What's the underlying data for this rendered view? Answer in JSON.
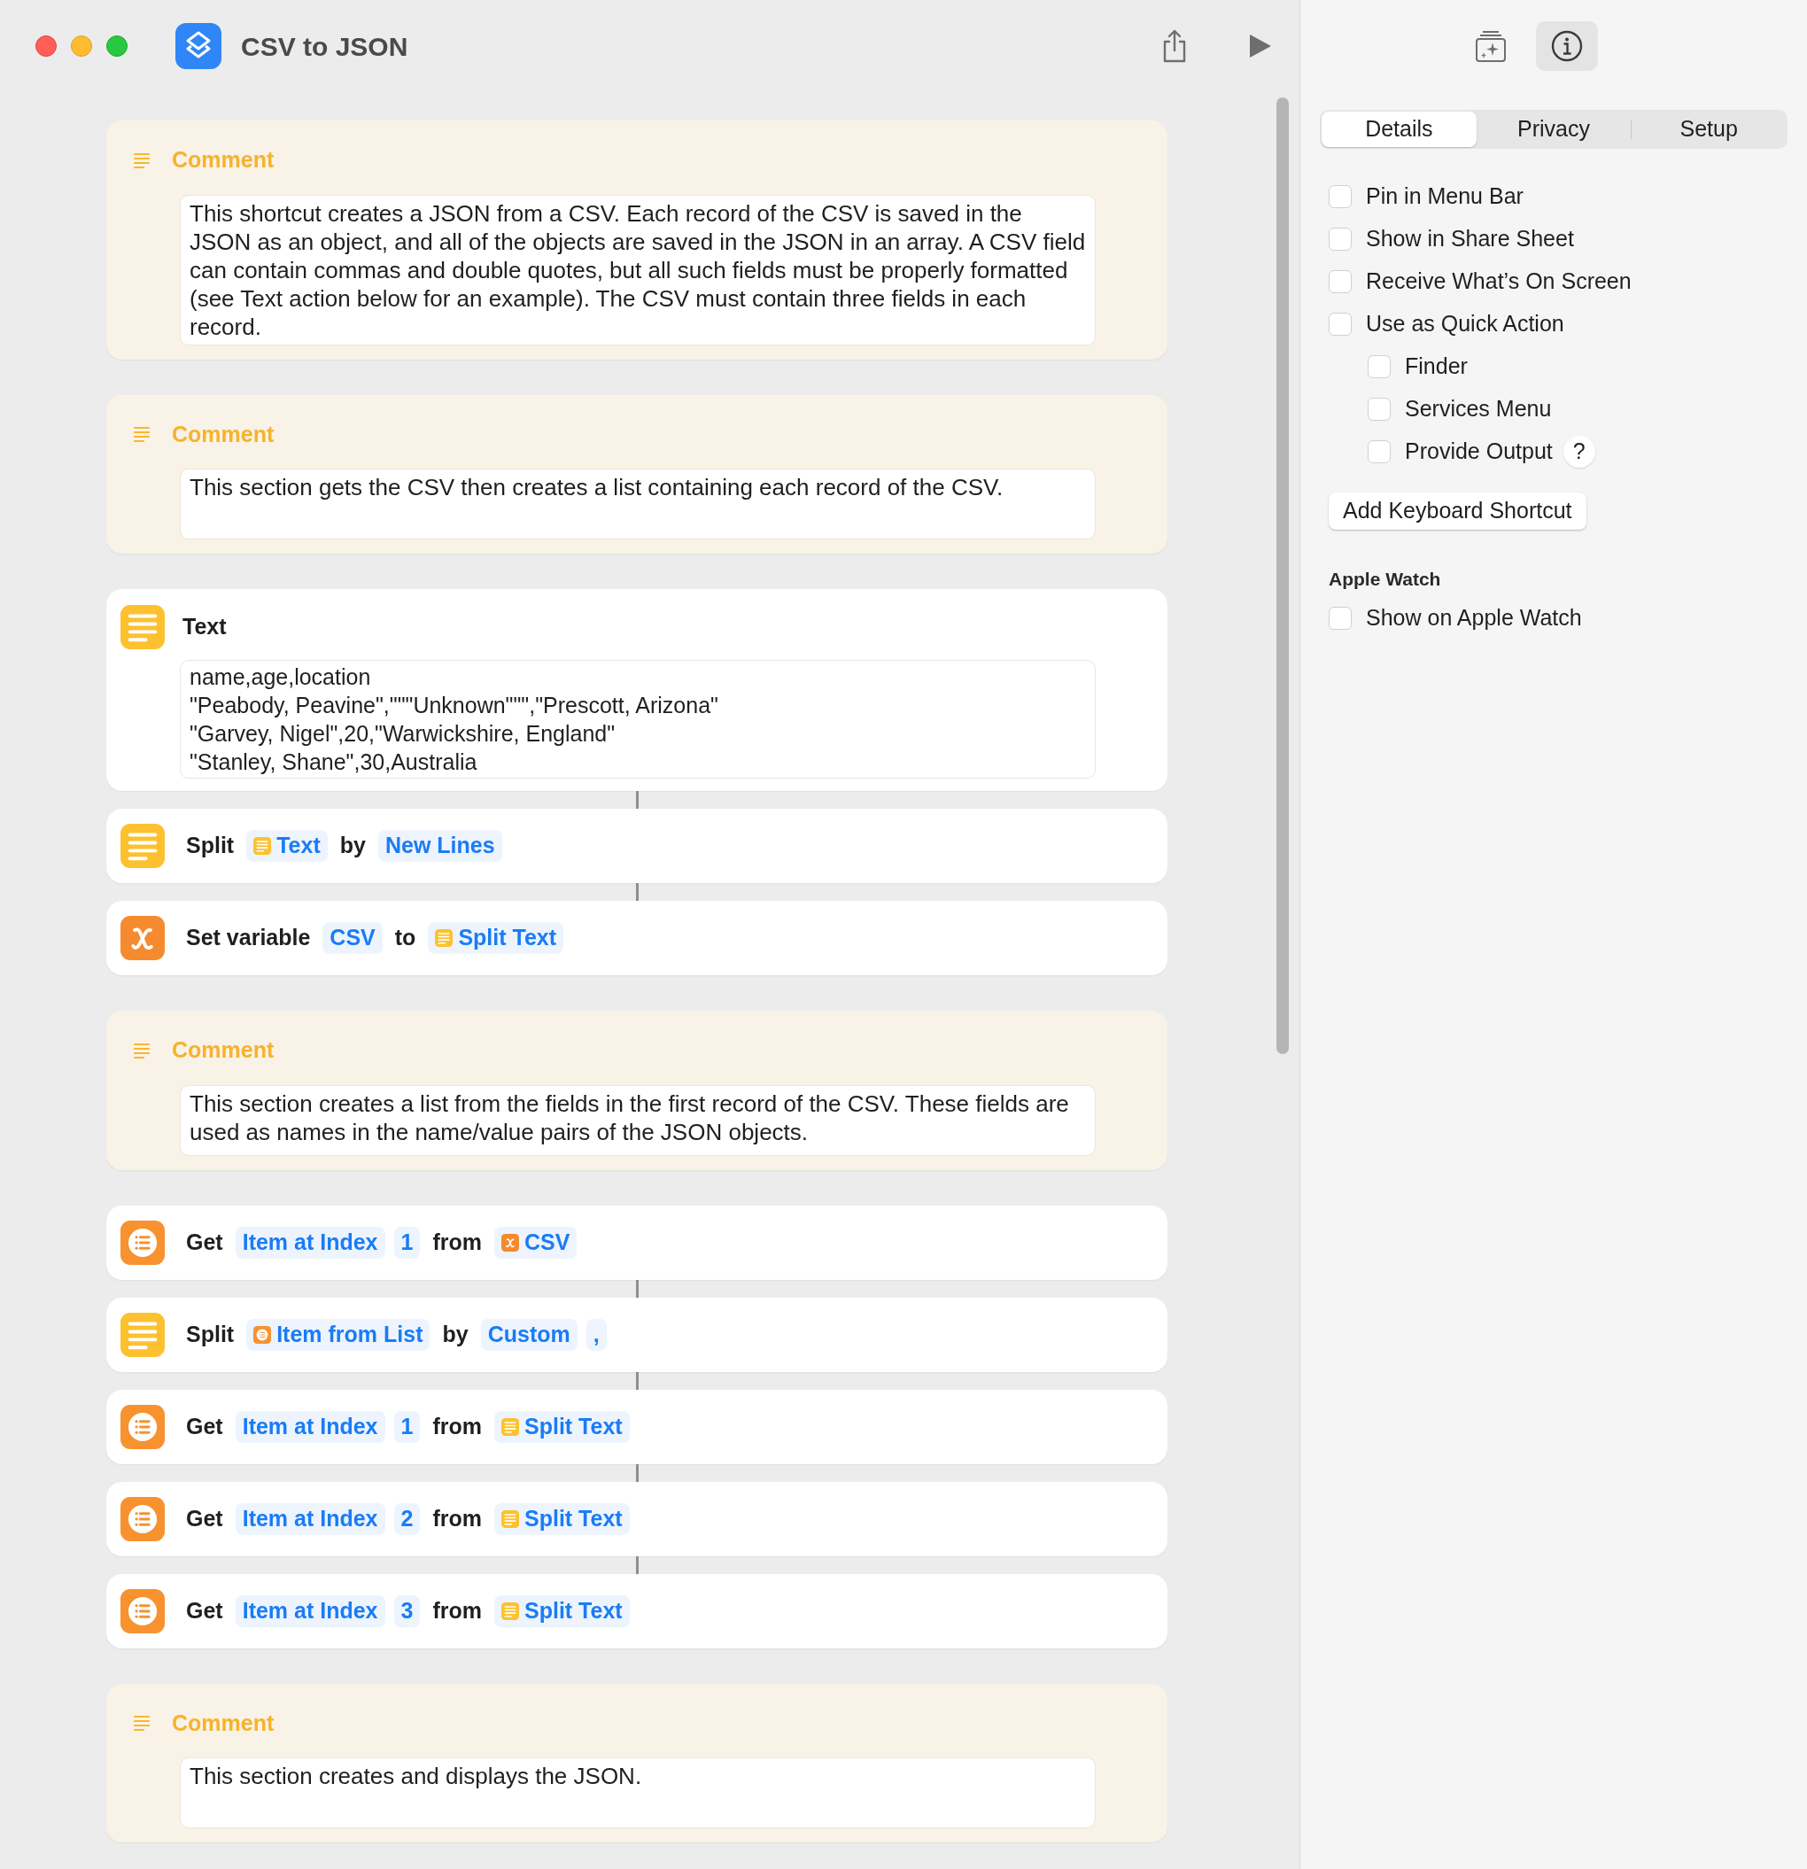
{
  "window": {
    "title": "CSV to JSON"
  },
  "blocks": [
    {
      "kind": "comment",
      "title": "Comment",
      "body": "This shortcut creates a JSON from a CSV. Each record of the CSV is saved in the JSON as an object, and all of the objects are saved in the JSON in an array.  A CSV field can contain commas and double quotes, but all such fields must be properly formatted (see Text action below for an example). The CSV must contain three fields in each record."
    },
    {
      "kind": "comment",
      "title": "Comment",
      "body": "This section gets the CSV then creates a list containing each record of the CSV."
    },
    {
      "kind": "text",
      "title": "Text",
      "lines": [
        "name,age,location",
        "\"Peabody, Peavine\",\"\"\"Unknown\"\"\",\"Prescott, Arizona\"",
        "\"Garvey, Nigel\",20,\"Warwickshire, England\"",
        "\"Stanley, Shane\",30,Australia"
      ]
    },
    {
      "kind": "split_text",
      "parts": [
        {
          "kind": "word",
          "text": "Split"
        },
        {
          "kind": "text_token",
          "text": "Text"
        },
        {
          "kind": "word",
          "text": "by"
        },
        {
          "kind": "token",
          "text": "New Lines"
        }
      ]
    },
    {
      "kind": "set_variable",
      "parts": [
        {
          "kind": "word",
          "text": "Set variable"
        },
        {
          "kind": "token",
          "text": "CSV"
        },
        {
          "kind": "word",
          "text": "to"
        },
        {
          "kind": "text_token",
          "text": "Split Text"
        }
      ]
    },
    {
      "kind": "comment",
      "title": "Comment",
      "body": "This section creates a list from the fields in the first record of the CSV. These fields are used as names in the name/value pairs of the JSON objects."
    },
    {
      "kind": "get_item",
      "parts": [
        {
          "kind": "word",
          "text": "Get"
        },
        {
          "kind": "token",
          "text": "Item at Index"
        },
        {
          "kind": "token",
          "text": "1"
        },
        {
          "kind": "word",
          "text": "from"
        },
        {
          "kind": "variable_token",
          "text": "CSV"
        }
      ]
    },
    {
      "kind": "split_text",
      "parts": [
        {
          "kind": "word",
          "text": "Split"
        },
        {
          "kind": "list_token",
          "text": "Item from List"
        },
        {
          "kind": "word",
          "text": "by"
        },
        {
          "kind": "token",
          "text": "Custom"
        },
        {
          "kind": "token",
          "text": ","
        }
      ]
    },
    {
      "kind": "get_item",
      "parts": [
        {
          "kind": "word",
          "text": "Get"
        },
        {
          "kind": "token",
          "text": "Item at Index"
        },
        {
          "kind": "token",
          "text": "1"
        },
        {
          "kind": "word",
          "text": "from"
        },
        {
          "kind": "text_token",
          "text": "Split Text"
        }
      ]
    },
    {
      "kind": "get_item",
      "parts": [
        {
          "kind": "word",
          "text": "Get"
        },
        {
          "kind": "token",
          "text": "Item at Index"
        },
        {
          "kind": "token",
          "text": "2"
        },
        {
          "kind": "word",
          "text": "from"
        },
        {
          "kind": "text_token",
          "text": "Split Text"
        }
      ]
    },
    {
      "kind": "get_item",
      "parts": [
        {
          "kind": "word",
          "text": "Get"
        },
        {
          "kind": "token",
          "text": "Item at Index"
        },
        {
          "kind": "token",
          "text": "3"
        },
        {
          "kind": "word",
          "text": "from"
        },
        {
          "kind": "text_token",
          "text": "Split Text"
        }
      ]
    },
    {
      "kind": "comment",
      "title": "Comment",
      "body": "This section creates and displays the JSON."
    }
  ],
  "inspector": {
    "toolbar": [
      {
        "kind": "gallery",
        "selected": false
      },
      {
        "kind": "info",
        "selected": true
      }
    ],
    "tabs": [
      {
        "label": "Details",
        "selected": true
      },
      {
        "label": "Privacy",
        "selected": false
      },
      {
        "label": "Setup",
        "selected": false
      }
    ],
    "options": [
      {
        "label": "Pin in Menu Bar",
        "checked": false
      },
      {
        "label": "Show in Share Sheet",
        "checked": false
      },
      {
        "label": "Receive What’s On Screen",
        "checked": false
      },
      {
        "label": "Use as Quick Action",
        "checked": false,
        "children": [
          {
            "label": "Finder",
            "checked": false
          },
          {
            "label": "Services Menu",
            "checked": false
          },
          {
            "label": "Provide Output",
            "checked": false,
            "help": "?"
          }
        ]
      }
    ],
    "shortcut_button": "Add Keyboard Shortcut",
    "sections": [
      {
        "title": "Apple Watch",
        "options": [
          {
            "label": "Show on Apple Watch",
            "checked": false
          }
        ]
      }
    ]
  }
}
